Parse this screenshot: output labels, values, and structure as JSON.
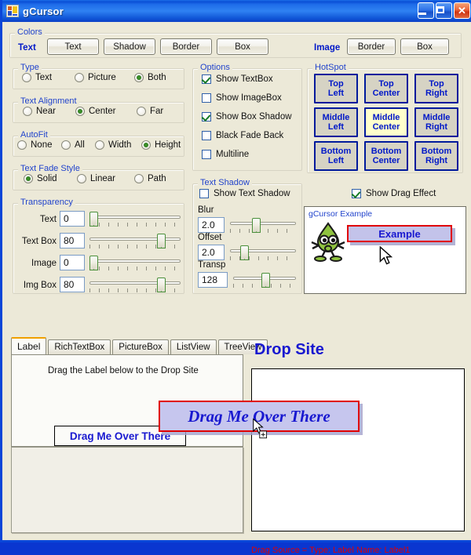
{
  "window": {
    "title": "gCursor",
    "icon": "app-icon",
    "buttons": {
      "minimize": "_",
      "maximize": "□",
      "close": "✕"
    }
  },
  "colors_group": {
    "title": "Colors",
    "text_label": "Text",
    "text_buttons": [
      "Text",
      "Shadow",
      "Border",
      "Box"
    ],
    "image_label": "Image",
    "image_buttons": [
      "Border",
      "Box"
    ]
  },
  "type_group": {
    "title": "Type",
    "options": [
      {
        "label": "Text",
        "selected": false
      },
      {
        "label": "Picture",
        "selected": false
      },
      {
        "label": "Both",
        "selected": true
      }
    ]
  },
  "text_alignment_group": {
    "title": "Text Alignment",
    "options": [
      {
        "label": "Near",
        "selected": false
      },
      {
        "label": "Center",
        "selected": true
      },
      {
        "label": "Far",
        "selected": false
      }
    ]
  },
  "autofit_group": {
    "title": "AutoFit",
    "options": [
      {
        "label": "None",
        "selected": false
      },
      {
        "label": "All",
        "selected": false
      },
      {
        "label": "Width",
        "selected": false
      },
      {
        "label": "Height",
        "selected": true
      }
    ]
  },
  "text_fade_style_group": {
    "title": "Text Fade Style",
    "options": [
      {
        "label": "Solid",
        "selected": true
      },
      {
        "label": "Linear",
        "selected": false
      },
      {
        "label": "Path",
        "selected": false
      }
    ]
  },
  "transparency_group": {
    "title": "Transparency",
    "rows": [
      {
        "label": "Text",
        "value": "0",
        "percent": 0
      },
      {
        "label": "Text Box",
        "value": "80",
        "percent": 80
      },
      {
        "label": "Image",
        "value": "0",
        "percent": 0
      },
      {
        "label": "Img Box",
        "value": "80",
        "percent": 80
      }
    ]
  },
  "options_group": {
    "title": "Options",
    "items": [
      {
        "label": "Show TextBox",
        "checked": true
      },
      {
        "label": "Show ImageBox",
        "checked": false
      },
      {
        "label": "Show Box Shadow",
        "checked": true
      },
      {
        "label": "Black Fade Back",
        "checked": false
      },
      {
        "label": "Multiline",
        "checked": false
      }
    ]
  },
  "text_shadow_group": {
    "title": "Text Shadow",
    "checkbox": {
      "label": "Show Text Shadow",
      "checked": false
    },
    "rows": [
      {
        "label": "Blur",
        "value": "2.0",
        "percent": 36
      },
      {
        "label": "Offset",
        "value": "2.0",
        "percent": 18
      },
      {
        "label": "Transp",
        "value": "128",
        "percent": 50
      }
    ]
  },
  "hotspot_group": {
    "title": "HotSpot",
    "cells": [
      {
        "line1": "Top",
        "line2": "Left",
        "selected": false
      },
      {
        "line1": "Top",
        "line2": "Center",
        "selected": false
      },
      {
        "line1": "Top",
        "line2": "Right",
        "selected": false
      },
      {
        "line1": "Middle",
        "line2": "Left",
        "selected": false
      },
      {
        "line1": "Middle",
        "line2": "Center",
        "selected": true
      },
      {
        "line1": "Middle",
        "line2": "Right",
        "selected": false
      },
      {
        "line1": "Bottom",
        "line2": "Left",
        "selected": false
      },
      {
        "line1": "Bottom",
        "line2": "Center",
        "selected": false
      },
      {
        "line1": "Bottom",
        "line2": "Right",
        "selected": false
      }
    ],
    "drag_effect": {
      "label": "Show Drag Effect",
      "checked": true
    }
  },
  "preview": {
    "caption": "gCursor Example",
    "example_text": "Example",
    "mascot": "green-mascot-icon",
    "cursor": "arrow-cursor"
  },
  "tabs": {
    "items": [
      "Label",
      "RichTextBox",
      "PictureBox",
      "ListView",
      "TreeView"
    ],
    "active": "Label"
  },
  "label_page": {
    "instruction": "Drag the Label below to the Drop Site",
    "drag_label": "Drag Me Over There"
  },
  "drop_site": {
    "title": "Drop Site",
    "status": "Drag Source = Type: Label  Name: Label1"
  },
  "drag_ghost": {
    "text": "Drag Me Over There",
    "cursor": "drag-copy-cursor"
  },
  "theme": {
    "accent_blue": "#2244cc",
    "label_blue": "#0018c8",
    "status_red": "#e00000",
    "window_bg": "#ece9d8",
    "selected_tab_bar": "#f0a000",
    "hotspot_selected_bg": "#ffffcc"
  }
}
